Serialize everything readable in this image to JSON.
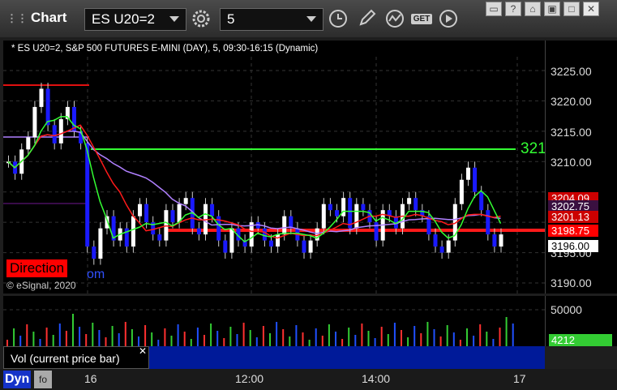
{
  "toolbar": {
    "title": "Chart",
    "symbol": "ES U20=2",
    "interval": "5",
    "get_label": "GET"
  },
  "chart": {
    "legend": "* ES U20=2, S&P 500 FUTURES E-MINI (DAY), 5, 09:30-16:15 (Dynamic)",
    "price_labels": [
      "3225.00",
      "3220.00",
      "3215.00",
      "3210.00",
      "3195.00",
      "3190.00"
    ],
    "price_tags": [
      {
        "text": "3204.09",
        "bg": "#cc0000",
        "fg": "#ffffff"
      },
      {
        "text": "3202.75",
        "bg": "#3a1040",
        "fg": "#ffffff"
      },
      {
        "text": "3201.13",
        "bg": "#cc0000",
        "fg": "#ffffff"
      },
      {
        "text": "3198.75",
        "bg": "#ff0000",
        "fg": "#ffffff"
      },
      {
        "text": "3196.00",
        "bg": "#ffffff",
        "fg": "#000000"
      }
    ],
    "green_line_label": "321",
    "direction_label": "Direction",
    "copyright": "© eSignal, 2020",
    "partial_text": "om"
  },
  "volume": {
    "label": "50000",
    "current_tag": "4212",
    "panel_label": "Vol (current price bar)"
  },
  "time_axis": {
    "mode": "Dyn",
    "labels": [
      "16",
      "12:00",
      "14:00",
      "17"
    ]
  },
  "colors": {
    "up": "#ffffff",
    "down": "#1a1aff",
    "ma_red": "#ff1a1a",
    "ma_green": "#33ff33",
    "ma_purple": "#b080ff",
    "volume_bar": "#3060ff"
  }
}
